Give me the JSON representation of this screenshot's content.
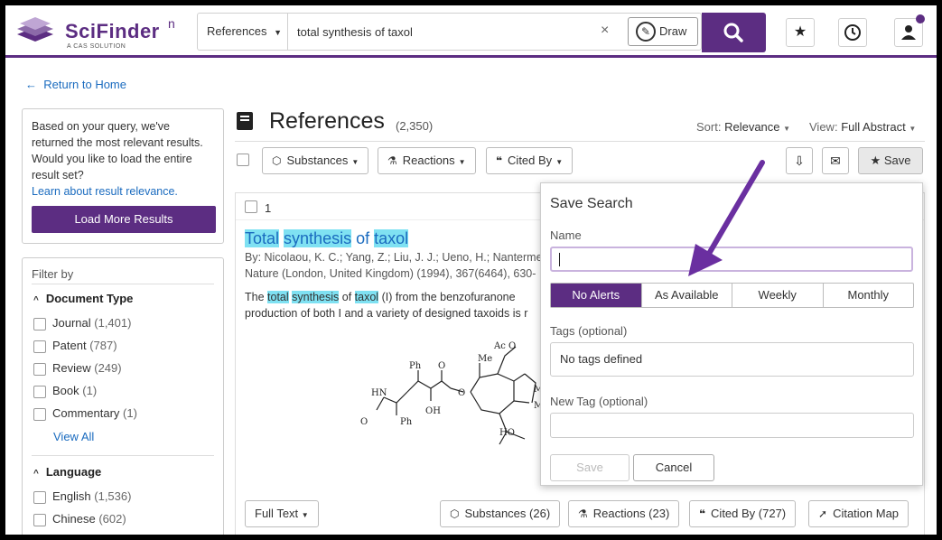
{
  "app": {
    "logo_name": "SciFinder",
    "logo_sup": "n",
    "logo_sub": "A CAS SOLUTION",
    "accent_color": "#5c2d82"
  },
  "search": {
    "type_label": "References",
    "query": "total synthesis of taxol",
    "clear": "×",
    "draw_label": "Draw"
  },
  "nav": {
    "return_home": "Return to Home"
  },
  "suggest": {
    "text": "Based on your query, we've returned the most relevant results. Would you like to load the entire result set?",
    "link": "Learn about result relevance.",
    "button": "Load More Results"
  },
  "filters": {
    "title": "Filter by",
    "doc_type": {
      "heading": "Document Type",
      "items": [
        {
          "label": "Journal",
          "count": "(1,401)"
        },
        {
          "label": "Patent",
          "count": "(787)"
        },
        {
          "label": "Review",
          "count": "(249)"
        },
        {
          "label": "Book",
          "count": "(1)"
        },
        {
          "label": "Commentary",
          "count": "(1)"
        }
      ],
      "view_all": "View All"
    },
    "language": {
      "heading": "Language",
      "items": [
        {
          "label": "English",
          "count": "(1,536)"
        },
        {
          "label": "Chinese",
          "count": "(602)"
        }
      ]
    }
  },
  "results": {
    "title": "References",
    "count": "(2,350)",
    "sort_label": "Sort:",
    "sort_value": "Relevance",
    "view_label": "View:",
    "view_value": "Full Abstract",
    "toolbar": {
      "substances": "Substances",
      "reactions": "Reactions",
      "cited_by": "Cited By",
      "save": "Save"
    },
    "item": {
      "number": "1",
      "title_words": [
        "Total",
        "synthesis",
        "of",
        "taxol"
      ],
      "authors": "By: Nicolaou, K. C.; Yang, Z.; Liu, J. J.; Ueno, H.; Nantermet",
      "journal": "Nature (London, United Kingdom) (1994), 367(6464), 630-",
      "abstract_1": "from the benzofuranone",
      "abstract_2": "production of both I and a variety of designed taxoids is r",
      "abstract_prefix": "The",
      "abstract_w1": "total",
      "abstract_w2": "synthesis",
      "abstract_of": "of",
      "abstract_w3": "taxol",
      "abstract_i": "(I)",
      "buttons": {
        "full_text": "Full Text",
        "substances": "Substances (26)",
        "reactions": "Reactions (23)",
        "cited_by": "Cited By (727)",
        "citation_map": "Citation Map"
      }
    }
  },
  "save_search": {
    "title": "Save Search",
    "name_label": "Name",
    "alerts": [
      "No Alerts",
      "As Available",
      "Weekly",
      "Monthly"
    ],
    "active_alert": 0,
    "tags_label": "Tags (optional)",
    "tags_value": "No tags defined",
    "new_tag_label": "New Tag (optional)",
    "save": "Save",
    "cancel": "Cancel"
  },
  "structure": {
    "labels": [
      "Ac O",
      "Ph",
      "O",
      "Me",
      "HN",
      "O",
      "Me",
      "Me",
      "O",
      "OH",
      "Ph",
      "HO",
      "O"
    ]
  }
}
